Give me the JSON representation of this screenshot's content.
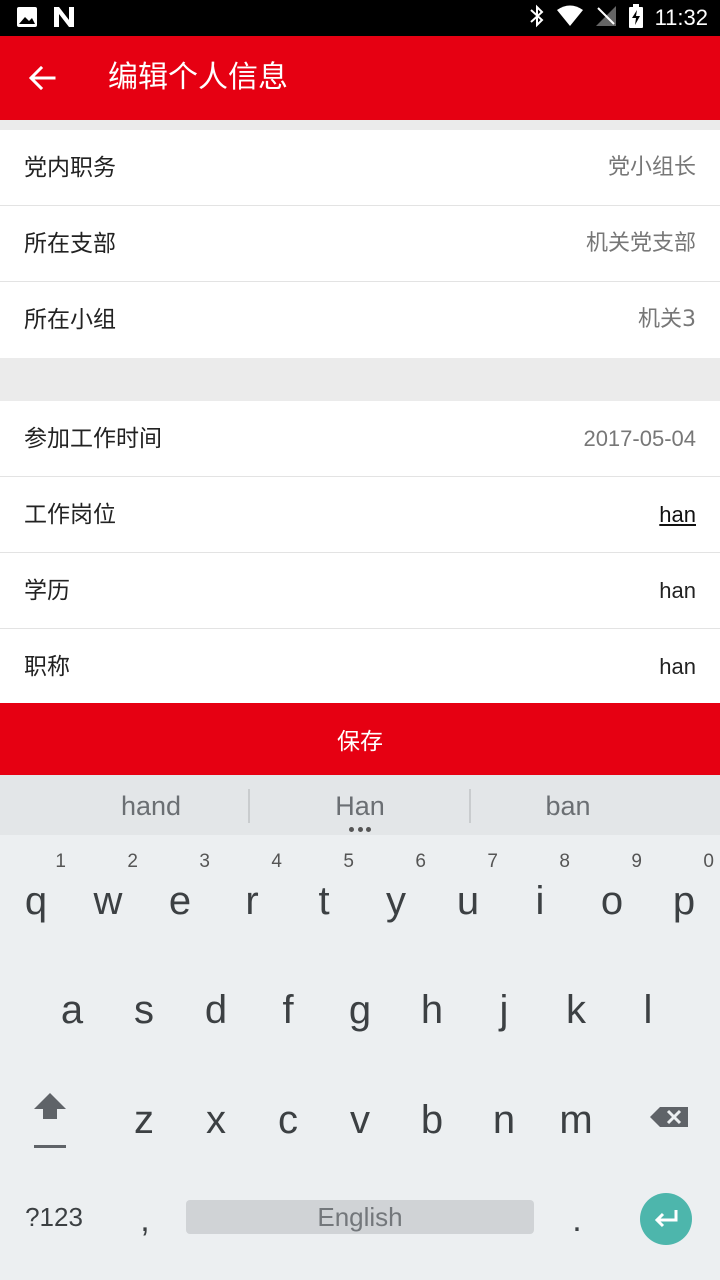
{
  "status_bar": {
    "time": "11:32",
    "icons": [
      "image-icon",
      "n-icon",
      "bluetooth-icon",
      "wifi-icon",
      "no-sim-icon",
      "battery-charging-icon"
    ]
  },
  "app_bar": {
    "title": "编辑个人信息",
    "back_icon": "arrow-back-icon"
  },
  "section_party": {
    "rows": [
      {
        "label": "党内职务",
        "value": "党小组长"
      },
      {
        "label": "所在支部",
        "value": "机关党支部"
      },
      {
        "label": "所在小组",
        "value": "机关3"
      }
    ]
  },
  "section_work": {
    "rows": [
      {
        "label": "参加工作时间",
        "value": "2017-05-04"
      },
      {
        "label": "工作岗位",
        "value": "han"
      },
      {
        "label": "学历",
        "value": "han"
      },
      {
        "label": "职称",
        "value": "han"
      }
    ]
  },
  "save_button": {
    "label": "保存"
  },
  "colors": {
    "brand_red": "#e60012",
    "enter_teal": "#4db6ac"
  },
  "keyboard": {
    "suggestions": [
      "hand",
      "Han",
      "ban"
    ],
    "row1": [
      {
        "key": "q",
        "hint": "1"
      },
      {
        "key": "w",
        "hint": "2"
      },
      {
        "key": "e",
        "hint": "3"
      },
      {
        "key": "r",
        "hint": "4"
      },
      {
        "key": "t",
        "hint": "5"
      },
      {
        "key": "y",
        "hint": "6"
      },
      {
        "key": "u",
        "hint": "7"
      },
      {
        "key": "i",
        "hint": "8"
      },
      {
        "key": "o",
        "hint": "9"
      },
      {
        "key": "p",
        "hint": "0"
      }
    ],
    "row2": [
      "a",
      "s",
      "d",
      "f",
      "g",
      "h",
      "j",
      "k",
      "l"
    ],
    "row3": [
      "z",
      "x",
      "c",
      "v",
      "b",
      "n",
      "m"
    ],
    "symbols_label": "?123",
    "comma": ",",
    "space_label": "English",
    "period": "."
  }
}
